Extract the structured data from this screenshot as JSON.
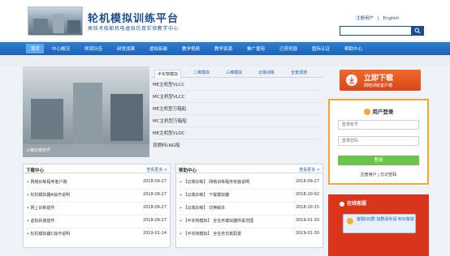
{
  "header": {
    "title": "轮机模拟训练平台",
    "subtitle": "高技术船舶机电虚拟仿真实验教学中心",
    "top_links": [
      "注册用户",
      "|",
      "English"
    ],
    "search_placeholder": ""
  },
  "nav": {
    "items": [
      "首页",
      "中心概况",
      "师资队伍",
      "研发成果",
      "虚拟拆装",
      "教学视频",
      "教学资源",
      "推广使用",
      "已获奖励",
      "国际认证",
      "帮助中心"
    ],
    "active_index": 0
  },
  "photo": {
    "caption": "三维仿真软件"
  },
  "product_tabs": {
    "items": [
      "半实物模拟",
      "二维模拟",
      "三维模拟",
      "云端训练",
      "全景漫游"
    ],
    "active_index": 0
  },
  "products": [
    "ME主机型VLCC",
    "MC主机型VLCC",
    "ME主机型万箱船",
    "MC主机型万箱船",
    "ME主机型VLOC",
    "双燃料LNG船"
  ],
  "download_panel": {
    "title": "下载中心",
    "more": "查看更多 >",
    "rows": [
      {
        "title": "• 网络训练程序客户端",
        "date": "2018-09-27"
      },
      {
        "title": "• 轮机模拟器A操作说明",
        "date": "2018-09-27"
      },
      {
        "title": "• 网上训练插件",
        "date": "2018-09-27"
      },
      {
        "title": "• 虚拟拆装插件",
        "date": "2018-09-27"
      },
      {
        "title": "• 轮机模拟器C操作说明",
        "date": "2019-01-14"
      }
    ]
  },
  "help_panel": {
    "title": "帮助中心",
    "more": "查看更多 >",
    "rows": [
      {
        "title": "• 【云端训练】 网络训练程序安装说明",
        "date": "2018-09-27"
      },
      {
        "title": "• 【云端训练】 下载模拟器",
        "date": "2018-10-02"
      },
      {
        "title": "• 【云端训练】 切换版本",
        "date": "2018-10-15"
      },
      {
        "title": "• 【半实物模拟】 全任务模拟器所属范围",
        "date": "2019-01-30"
      },
      {
        "title": "• 【半实物模拟】 全任务仿真配置",
        "date": "2019-01-30"
      }
    ]
  },
  "download_box": {
    "title": "立即下载",
    "subtitle": "网络训练客户端"
  },
  "login": {
    "title": "用户登录",
    "account_placeholder": "登录账号",
    "password_placeholder": "登录密码",
    "button": "登录",
    "links": "注册用户 | 忘记密码"
  },
  "service": {
    "title": "在线客服",
    "card_text": "客服QQ群 加群请你请 知识答疑"
  },
  "colors": {
    "brand": "#1d4f8f",
    "nav": "#1b63b5",
    "download": "#e8541f",
    "login_border": "#f0a830",
    "login_button": "#6cc24a",
    "service": "#d9351b"
  }
}
